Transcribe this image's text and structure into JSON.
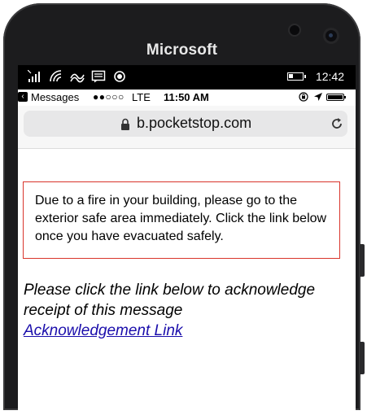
{
  "device": {
    "brand": "Microsoft"
  },
  "windows_status": {
    "time": "12:42",
    "icons": [
      "signal-bars-icon",
      "wifi-icon",
      "data-sense-icon",
      "message-icon",
      "location-record-icon"
    ]
  },
  "ios_status": {
    "back_app": "Messages",
    "signal": "●●○○○",
    "network": "LTE",
    "time": "11:50 AM"
  },
  "browser": {
    "url": "b.pocketstop.com"
  },
  "content": {
    "alert_text": "Due to a fire in your building, please go to the exterior safe area immediately. Click the link below once you have evacuated safely.",
    "ack_text": "Please click the link below to acknowledge receipt of this message",
    "ack_link": "Acknowledgement Link"
  },
  "colors": {
    "alert_border": "#d9342b",
    "link": "#1a0dab",
    "phone_body": "#1c1c1e"
  }
}
